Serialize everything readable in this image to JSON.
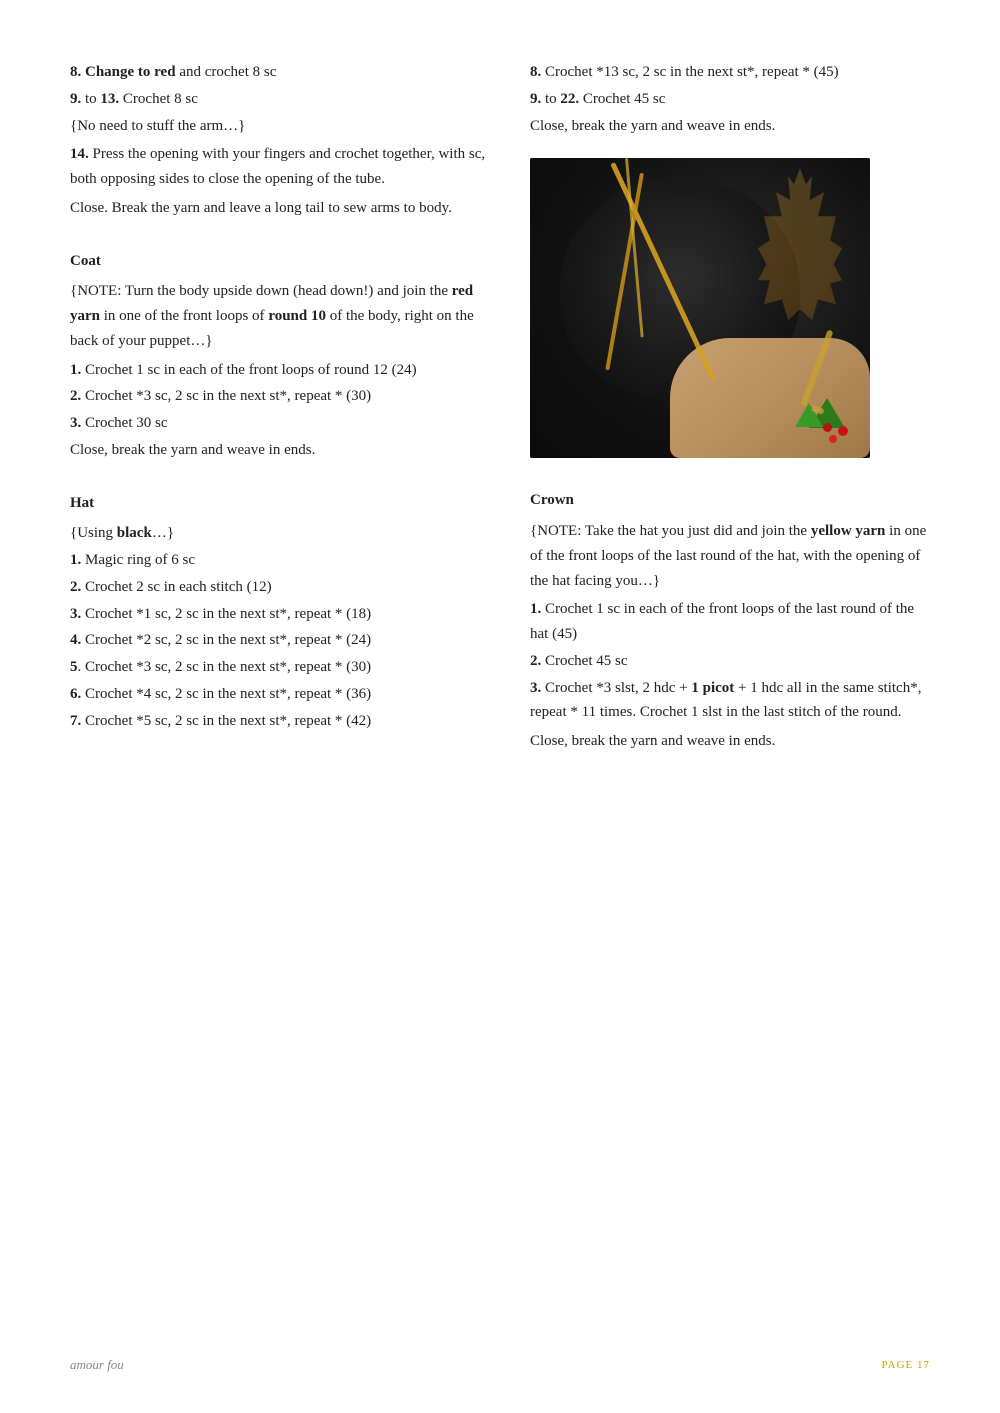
{
  "page": {
    "number": "PAGE 17",
    "brand": "amour fou"
  },
  "left": {
    "intro": [
      {
        "id": "line1",
        "html": "<span class='bold'>8. Change to red</span> and crochet 8 sc"
      },
      {
        "id": "line2",
        "html": "<span class='bold'>9.</span> to <span class='bold'>13.</span> Crochet 8 sc"
      },
      {
        "id": "line3",
        "html": "{No need to stuff the arm…}"
      },
      {
        "id": "line4",
        "html": "<span class='bold'>14.</span> Press the opening with your fingers and crochet together, with sc, both opposing sides to close the opening of the tube."
      },
      {
        "id": "line5",
        "html": "Close. Break the yarn and leave a long tail to sew arms to body."
      }
    ],
    "coat": {
      "title": "Coat",
      "lines": [
        {
          "id": "coat_note",
          "html": "{NOTE: Turn the body upside down (head down!) and join the <span class='bold'>red yarn</span> in one of the front loops of <span class='bold'>round 10</span> of the body, right on the back of your puppet…}"
        },
        {
          "id": "coat_1",
          "html": "<span class='bold'>1.</span> Crochet 1 sc in each of the front loops of round 12 (24)"
        },
        {
          "id": "coat_2",
          "html": "<span class='bold'>2.</span> Crochet *3 sc, 2 sc in the next st*, repeat * (30)"
        },
        {
          "id": "coat_3",
          "html": "<span class='bold'>3.</span> Crochet 30 sc"
        },
        {
          "id": "coat_close",
          "html": "Close, break the yarn and weave in ends."
        }
      ]
    },
    "hat": {
      "title": "Hat",
      "lines": [
        {
          "id": "hat_note",
          "html": "{Using <span class='bold'>black</span>…}"
        },
        {
          "id": "hat_1",
          "html": "<span class='bold'>1.</span> Magic ring of 6 sc"
        },
        {
          "id": "hat_2",
          "html": "<span class='bold'>2.</span> Crochet 2 sc in each stitch (12)"
        },
        {
          "id": "hat_3",
          "html": "<span class='bold'>3.</span> Crochet *1 sc, 2 sc in the next st*, repeat * (18)"
        },
        {
          "id": "hat_4",
          "html": "<span class='bold'>4.</span> Crochet *2 sc, 2 sc in the next st*, repeat * (24)"
        },
        {
          "id": "hat_5",
          "html": "<span class='bold'>5</span>. Crochet *3 sc, 2 sc in the next st*, repeat * (30)"
        },
        {
          "id": "hat_6",
          "html": "<span class='bold'>6.</span> Crochet *4 sc, 2 sc in the next st*, repeat * (36)"
        },
        {
          "id": "hat_7",
          "html": "<span class='bold'>7.</span> Crochet *5 sc, 2 sc in the next st*, repeat * (42)"
        }
      ]
    }
  },
  "right": {
    "hat_continued": [
      {
        "id": "hat_8",
        "html": "<span class='bold'>8.</span> Crochet *13 sc, 2 sc in the next st*, repeat * (45)"
      },
      {
        "id": "hat_9",
        "html": "<span class='bold'>9.</span> to <span class='bold'>22.</span> Crochet 45 sc"
      },
      {
        "id": "hat_close",
        "html": "Close, break the yarn and weave in ends."
      }
    ],
    "crown": {
      "title": "Crown",
      "lines": [
        {
          "id": "crown_note",
          "html": "{NOTE: Take the hat you just did and join the <span class='bold'>yellow yarn</span> in one of the front loops of the last round of the hat, with the opening of the hat facing you…}"
        },
        {
          "id": "crown_1",
          "html": "<span class='bold'>1.</span> Crochet 1 sc in each of the front loops of the last round of the hat (45)"
        },
        {
          "id": "crown_2",
          "html": "<span class='bold'>2.</span> Crochet 45 sc"
        },
        {
          "id": "crown_3",
          "html": "<span class='bold'>3.</span> Crochet *3 slst, 2 hdc + <span class='bold'>1 picot</span> + 1 hdc all in the same stitch*, repeat * 11 times. Crochet 1 slst in the last stitch of the round."
        },
        {
          "id": "crown_close",
          "html": "Close, break the yarn and weave in ends."
        }
      ]
    }
  }
}
